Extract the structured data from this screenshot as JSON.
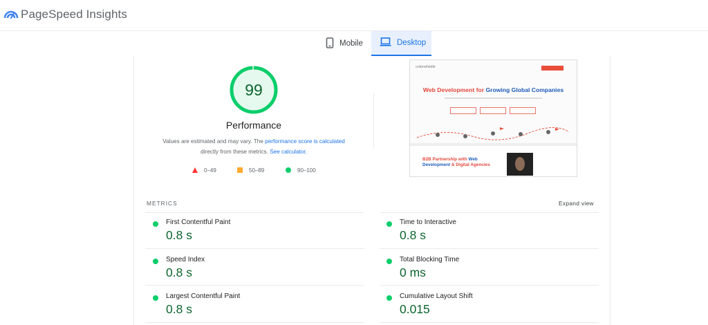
{
  "app": {
    "brand": "PageSpeed Insights"
  },
  "tabs": [
    {
      "label": "Mobile",
      "icon": "phone-icon",
      "active": false
    },
    {
      "label": "Desktop",
      "icon": "laptop-icon",
      "active": true
    }
  ],
  "performance": {
    "score": "99",
    "score_fraction": 0.99,
    "title": "Performance",
    "desc_part1": "Values are estimated and may vary. The ",
    "desc_link1": "performance score is calculated",
    "desc_part2": "directly from these metrics. ",
    "desc_link2": "See calculator."
  },
  "legend": [
    {
      "range": "0–49",
      "shape": "triangle",
      "color": "#ff3333"
    },
    {
      "range": "50–89",
      "shape": "square",
      "color": "#ffaa33"
    },
    {
      "range": "90–100",
      "shape": "circle",
      "color": "#0cce6b"
    }
  ],
  "screenshot": {
    "logo_text": "colorwhistle",
    "headline_part1": "Web Development for ",
    "headline_part2": "Growing Global Companies",
    "b2b_part1": "B2B Partnership with ",
    "b2b_part2": "Web Development",
    "b2b_part3": " & Digital Agencies"
  },
  "metrics": {
    "label": "METRICS",
    "expand_label": "Expand view",
    "items": [
      {
        "name": "First Contentful Paint",
        "value": "0.8 s"
      },
      {
        "name": "Time to Interactive",
        "value": "0.8 s"
      },
      {
        "name": "Speed Index",
        "value": "0.8 s"
      },
      {
        "name": "Total Blocking Time",
        "value": "0 ms"
      },
      {
        "name": "Largest Contentful Paint",
        "value": "0.8 s"
      },
      {
        "name": "Cumulative Layout Shift",
        "value": "0.015"
      }
    ]
  },
  "colors": {
    "pass": "#0cce6b",
    "pass_text": "#0d652d",
    "link": "#1a73e8",
    "tab_active_bg": "#e8f0fe"
  }
}
